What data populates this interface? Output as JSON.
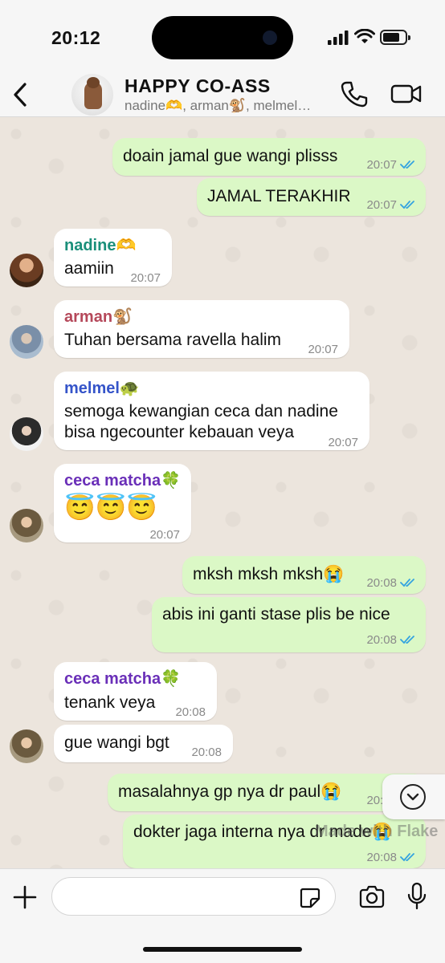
{
  "status_bar": {
    "time": "20:12"
  },
  "header": {
    "back_label": "Back",
    "group_name": "HAPPY CO-ASS",
    "members": "nadine🫶, arman🐒, melmel…"
  },
  "messages": [
    {
      "dir": "out",
      "text": "doain jamal gue wangi plisss",
      "time": "20:07",
      "read": true
    },
    {
      "dir": "out",
      "text": "JAMAL TERAKHIR",
      "time": "20:07",
      "read": true
    },
    {
      "dir": "in",
      "sender": "nadine🫶",
      "sender_color": "#1a8f7a",
      "text": "aamiin",
      "time": "20:07"
    },
    {
      "dir": "in",
      "sender": "arman🐒",
      "sender_color": "#b5485a",
      "text": "Tuhan bersama ravella halim",
      "time": "20:07"
    },
    {
      "dir": "in",
      "sender": "melmel🐢",
      "sender_color": "#3554c9",
      "text_lines": [
        "semoga kewangian ceca dan nadine",
        "bisa ngecounter kebauan veya"
      ],
      "time": "20:07"
    },
    {
      "dir": "in",
      "sender": "ceca matcha🍀",
      "sender_color": "#6a2fb8",
      "text": "😇😇😇",
      "time": "20:07"
    },
    {
      "dir": "out",
      "text": "mksh mksh mksh😭",
      "time": "20:08",
      "read": true
    },
    {
      "dir": "out",
      "text": "abis ini ganti stase plis be nice",
      "time": "20:08",
      "read": true
    },
    {
      "dir": "in",
      "sender": "ceca matcha🍀",
      "sender_color": "#6a2fb8",
      "text": "tenank veya",
      "time": "20:08"
    },
    {
      "dir": "in",
      "text": "gue wangi bgt",
      "time": "20:08"
    },
    {
      "dir": "out",
      "text": "masalahnya gp nya dr paul😭",
      "time": "20:08",
      "read": true
    },
    {
      "dir": "out",
      "text": "dokter jaga interna nya dr made😭",
      "time": "20:08",
      "read": true
    }
  ],
  "watermark": "Made with Flake",
  "input": {
    "placeholder": ""
  },
  "colors": {
    "outgoing": "#dbf8c6",
    "incoming": "#ffffff",
    "ticks": "#34a3e0",
    "background": "#ece5dd"
  },
  "icons": [
    "back-chevron-icon",
    "phone-icon",
    "video-camera-icon",
    "chevron-down-icon",
    "plus-icon",
    "sticker-icon",
    "camera-icon",
    "microphone-icon"
  ]
}
